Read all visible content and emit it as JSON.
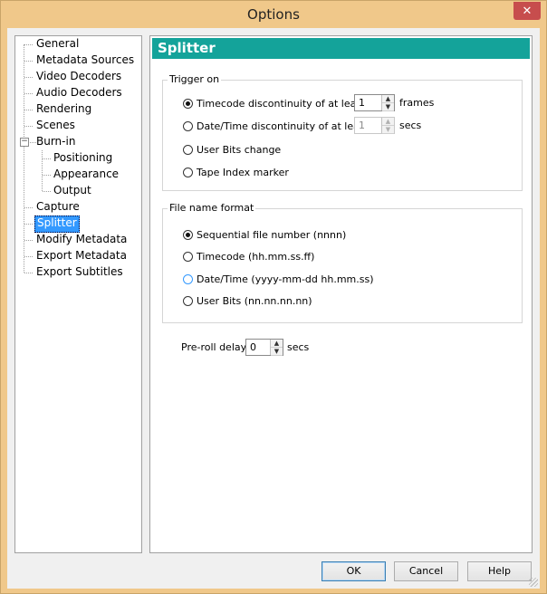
{
  "window": {
    "title": "Options",
    "close_glyph": "✕"
  },
  "tree": {
    "items": [
      {
        "label": "General"
      },
      {
        "label": "Metadata Sources"
      },
      {
        "label": "Video Decoders"
      },
      {
        "label": "Audio Decoders"
      },
      {
        "label": "Rendering"
      },
      {
        "label": "Scenes"
      },
      {
        "label": "Burn-in",
        "expander": "−"
      },
      {
        "label": "Positioning"
      },
      {
        "label": "Appearance"
      },
      {
        "label": "Output"
      },
      {
        "label": "Capture"
      },
      {
        "label": "Splitter",
        "selected": true
      },
      {
        "label": "Modify Metadata"
      },
      {
        "label": "Export Metadata"
      },
      {
        "label": "Export Subtitles"
      }
    ]
  },
  "page": {
    "title": "Splitter",
    "trigger": {
      "label": "Trigger on",
      "options": [
        {
          "label": "Timecode discontinuity of at least",
          "checked": true
        },
        {
          "label": "Date/Time discontinuity of at least",
          "checked": false
        },
        {
          "label": "User Bits change",
          "checked": false
        },
        {
          "label": "Tape Index marker",
          "checked": false
        }
      ],
      "timecode_value": "1",
      "timecode_unit": "frames",
      "datetime_value": "1",
      "datetime_unit": "secs"
    },
    "filename": {
      "label": "File name format",
      "options": [
        {
          "label": "Sequential file number (nnnn)",
          "checked": true
        },
        {
          "label": "Timecode (hh.mm.ss.ff)",
          "checked": false
        },
        {
          "label": "Date/Time (yyyy-mm-dd hh.mm.ss)",
          "checked": false
        },
        {
          "label": "User Bits (nn.nn.nn.nn)",
          "checked": false
        }
      ]
    },
    "preroll": {
      "label": "Pre-roll delay",
      "value": "0",
      "unit": "secs"
    }
  },
  "spin": {
    "up": "▲",
    "down": "▼"
  },
  "buttons": {
    "ok": "OK",
    "cancel": "Cancel",
    "help": "Help"
  },
  "colors": {
    "header_bg": "#14a39a",
    "selection": "#3399ff",
    "title_bar": "#f0c88a",
    "close_button": "#c74d4d"
  }
}
